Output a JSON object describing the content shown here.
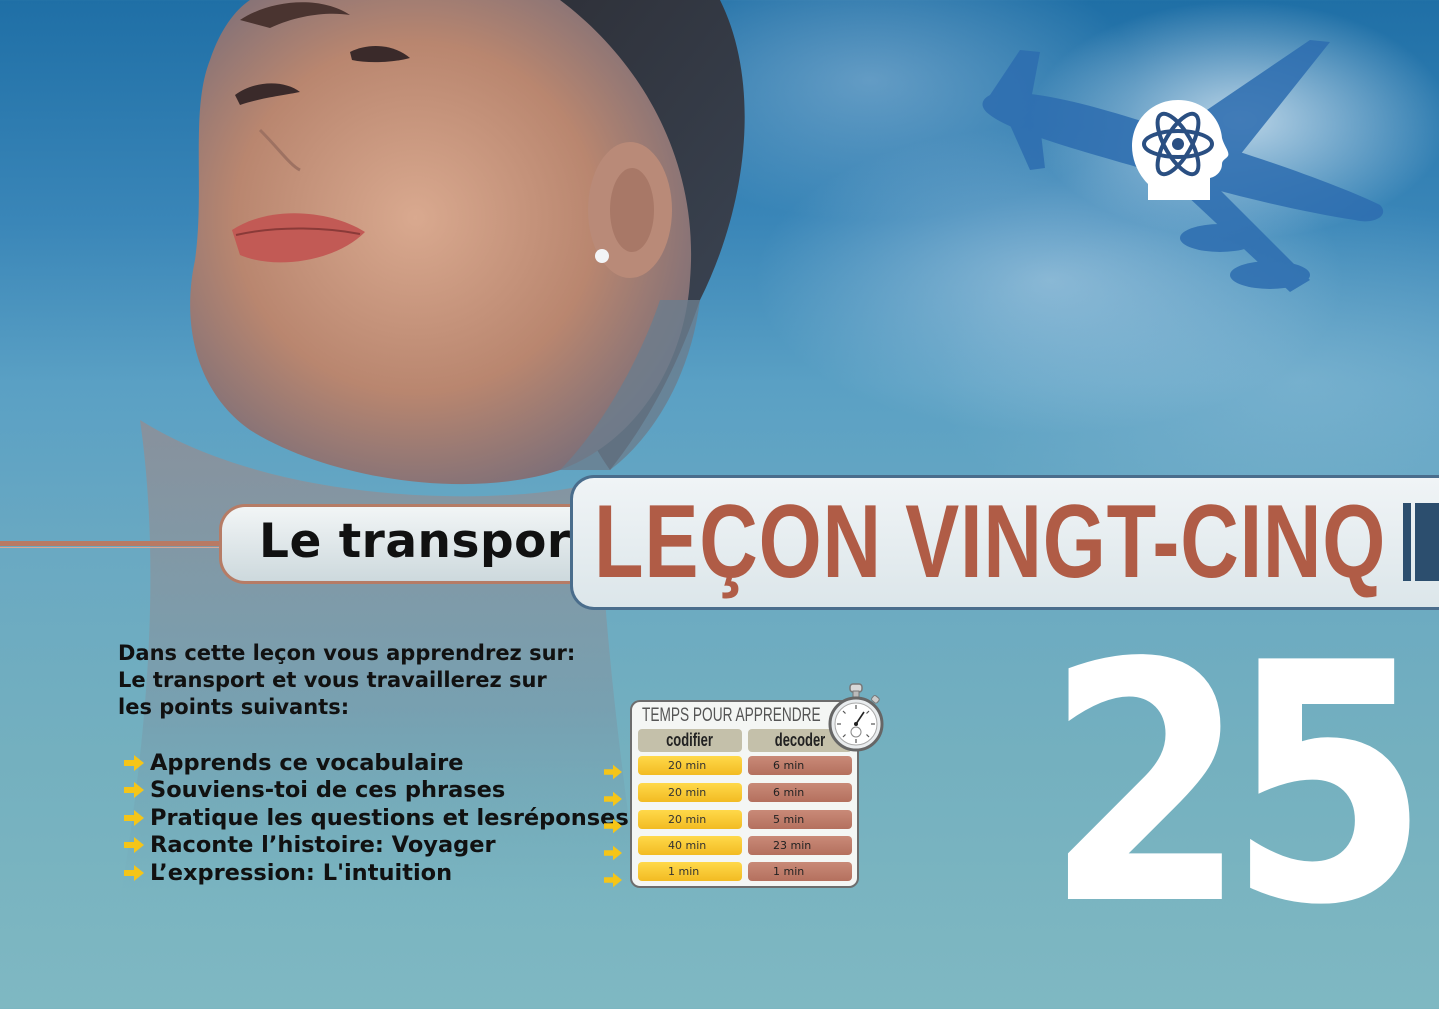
{
  "lesson": {
    "subtitle": "Le transport",
    "title": "LEÇON VINGT-CINQ",
    "number": "25"
  },
  "intro": {
    "text": "Dans cette leçon vous apprendrez sur: Le transport et vous travaillerez sur les points suivants:"
  },
  "points": [
    "Apprends ce vocabulaire",
    "Souviens-toi de ces phrases",
    "Pratique les questions et lesréponses",
    "Raconte l’histoire: Voyager",
    "L’expression: L'intuition"
  ],
  "time_table": {
    "title": "TEMPS POUR APPRENDRE",
    "col_codifier": "codifier",
    "col_decoder": "decoder",
    "rows": [
      {
        "codifier": "20 min",
        "decoder": "6 min"
      },
      {
        "codifier": "20 min",
        "decoder": "6 min"
      },
      {
        "codifier": "20 min",
        "decoder": "5 min"
      },
      {
        "codifier": "40 min",
        "decoder": "23 min"
      },
      {
        "codifier": "1 min",
        "decoder": "1 min"
      }
    ]
  },
  "colors": {
    "title_red": "#b05c46",
    "arrow_yellow": "#f5c518",
    "banner_border": "#4a6d8c"
  },
  "icons": [
    "brain-atom-icon",
    "airplane-icon",
    "arrow-right-icon",
    "stopwatch-icon"
  ]
}
